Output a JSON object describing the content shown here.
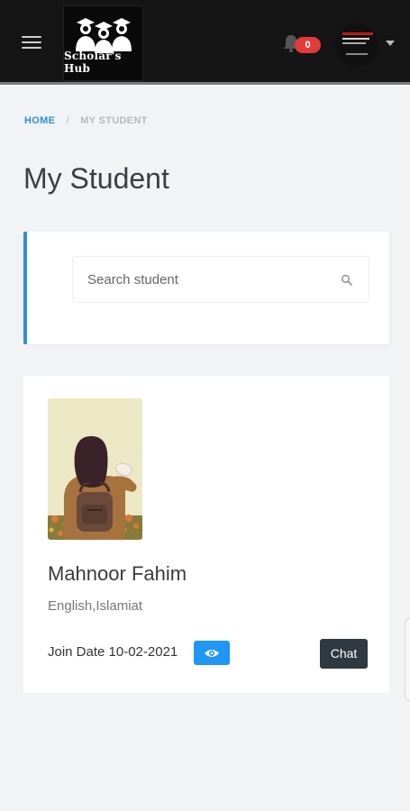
{
  "header": {
    "logo_text": "Scholar's Hub",
    "notification_count": "0"
  },
  "breadcrumb": {
    "home": "HOME",
    "separator": "/",
    "current": "MY STUDENT"
  },
  "page": {
    "title": "My Student"
  },
  "search": {
    "placeholder": "Search student"
  },
  "student": {
    "name": "Mahnoor Fahim",
    "subjects": "English,Islamiat",
    "join_date": "Join Date 10-02-2021",
    "chat_label": "Chat"
  },
  "colors": {
    "topbar": "#151515",
    "accent": "#2f8fd8",
    "badge": "#e23b3b",
    "view_button": "#2196f3",
    "chat_button": "#2f3942",
    "background": "#f2f3f5"
  },
  "icons": {
    "menu": "hamburger-icon",
    "notification": "bell-icon",
    "search": "search-icon",
    "view": "eye-icon",
    "dropdown": "chevron-down-icon"
  }
}
